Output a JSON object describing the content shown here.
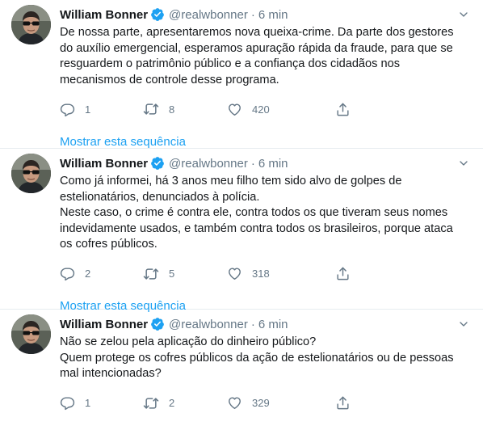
{
  "tweets": [
    {
      "name": "William Bonner",
      "handle": "@realwbonner",
      "separator": "·",
      "time": "6 min",
      "text": "De nossa parte, apresentaremos nova queixa-crime. Da parte dos gestores\ndo auxílio emergencial, esperamos apuração rápida da fraude, para que se\nresguardem o patrimônio público e a confiança dos cidadãos nos\nmecanismos de controle desse programa.",
      "replies": "1",
      "retweets": "8",
      "likes": "420",
      "show_thread": "Mostrar esta sequência"
    },
    {
      "name": "William Bonner",
      "handle": "@realwbonner",
      "separator": "·",
      "time": "6 min",
      "text": "Como já informei, há 3 anos meu filho tem sido alvo de golpes de\nestelionatários, denunciados à polícia.\nNeste caso, o crime é contra ele, contra todos os que tiveram seus nomes\nindevidamente usados, e também contra todos os brasileiros, porque ataca\nos cofres públicos.",
      "replies": "2",
      "retweets": "5",
      "likes": "318",
      "show_thread": "Mostrar esta sequência"
    },
    {
      "name": "William Bonner",
      "handle": "@realwbonner",
      "separator": "·",
      "time": "6 min",
      "text": "Não se zelou pela aplicação do dinheiro público?\nQuem protege os cofres públicos da ação de estelionatários ou de pessoas\nmal intencionadas?",
      "replies": "1",
      "retweets": "2",
      "likes": "329"
    }
  ],
  "icons": {
    "verified": "verified-badge-icon",
    "caret": "chevron-down-icon",
    "reply": "reply-icon",
    "retweet": "retweet-icon",
    "like": "heart-icon",
    "share": "share-icon",
    "avatar": "avatar"
  },
  "colors": {
    "accent": "#1da1f2",
    "muted": "#657786",
    "text": "#14171a",
    "divider": "#e6ecf0"
  }
}
